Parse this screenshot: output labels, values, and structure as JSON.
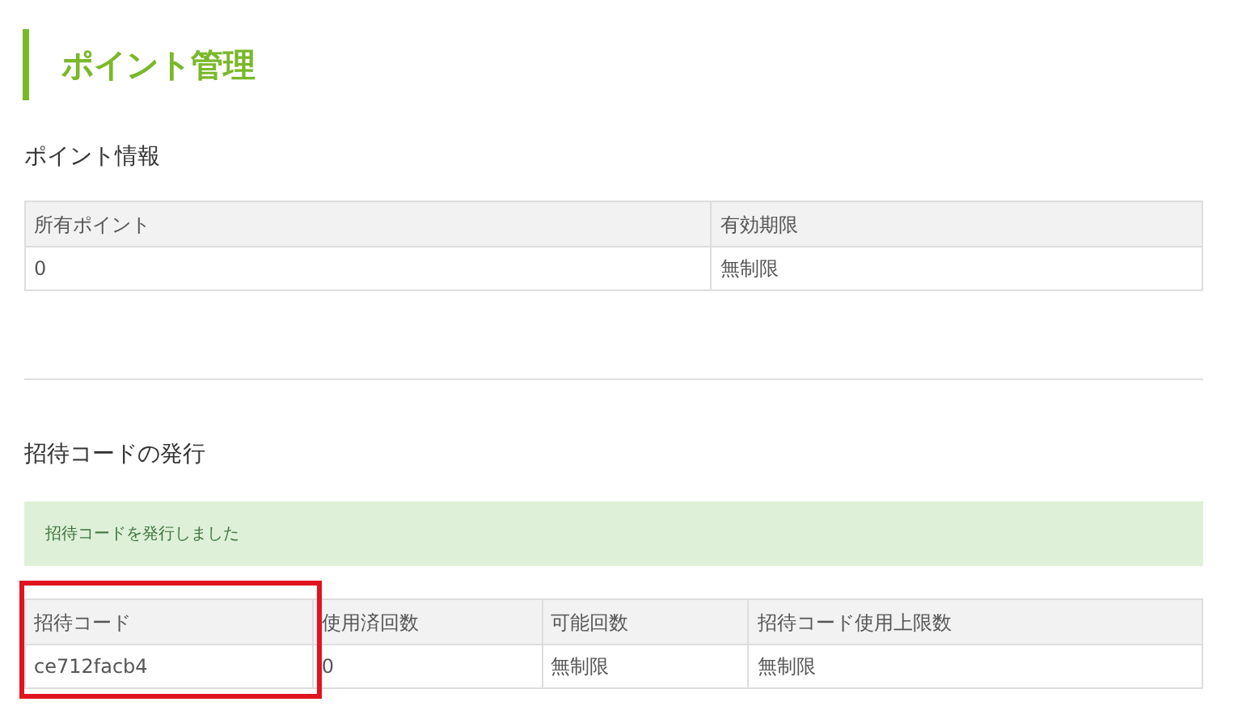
{
  "page_title": "ポイント管理",
  "point_info": {
    "heading": "ポイント情報",
    "columns": [
      {
        "label": "所有ポイント"
      },
      {
        "label": "有効期限"
      }
    ],
    "rows": [
      [
        "0",
        "無制限"
      ]
    ]
  },
  "invite": {
    "heading": "招待コードの発行",
    "alert": "招待コードを発行しました",
    "columns": [
      {
        "label": "招待コード",
        "highlighted": true
      },
      {
        "label": "使用済回数",
        "highlighted": false
      },
      {
        "label": "可能回数",
        "highlighted": false
      },
      {
        "label": "招待コード使用上限数",
        "highlighted": false
      }
    ],
    "rows": [
      [
        "ce712facb4",
        "0",
        "無制限",
        "無制限"
      ]
    ]
  }
}
